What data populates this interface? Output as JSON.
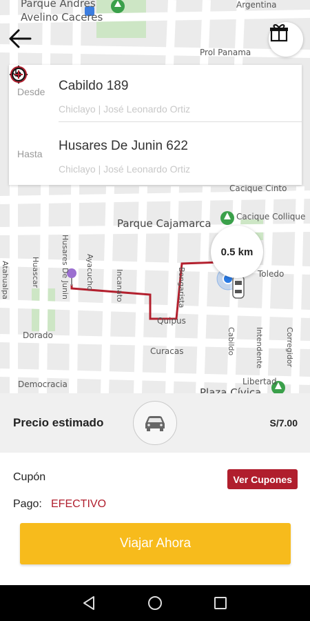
{
  "map": {
    "labels": {
      "parque_andres": "Parque Andres",
      "avelino_caceres": "Avelino Caceres",
      "argentina": "Argentina",
      "prol_panama": "Prol Panama",
      "cacique_cinto": "Cacique Cinto",
      "cacique_collique": "Cacique Collique",
      "parque_cajamarca": "Parque Cajamarca",
      "toledo": "Toledo",
      "atahualpa": "Atahualpa",
      "huascar": "Huascar",
      "husares_de_junin": "Husares De Junin",
      "ayacucho": "Ayacucho",
      "incanato": "Incanato",
      "bongarista": "Bongarista",
      "quipus": "Quipus",
      "curacas": "Curacas",
      "dorado": "Dorado",
      "democracia": "Democracia",
      "cabildo": "Cabildo",
      "intendente": "Intendente",
      "corregidor": "Corregidor",
      "libertad": "Libertad",
      "plaza_civica": "Plaza Cívica"
    },
    "distance": "0.5 km"
  },
  "route": {
    "from_label": "Desde",
    "from_title": "Cabildo 189",
    "from_sub": "Chiclayo | José Leonardo Ortiz",
    "to_label": "Hasta",
    "to_title": "Husares De Junin 622",
    "to_sub": "Chiclayo | José Leonardo Ortiz"
  },
  "price": {
    "label": "Precio estimado",
    "value": "S/7.00"
  },
  "coupon": {
    "label": "Cupón",
    "button": "Ver Cupones"
  },
  "payment": {
    "label": "Pago:",
    "value": "EFECTIVO"
  },
  "cta": "Viajar Ahora",
  "icons": {
    "back": "arrow-left-icon",
    "gift": "gift-icon",
    "locate": "crosshair-icon",
    "add": "plus-circle-icon",
    "car": "car-icon"
  },
  "colors": {
    "accent_red": "#b01e2d",
    "cta_yellow": "#f7bb1c",
    "route_red": "#b3202e",
    "marker_blue": "#2a7ae4",
    "marker_purple": "#9b6fd0",
    "park_green": "#cde6c5"
  }
}
